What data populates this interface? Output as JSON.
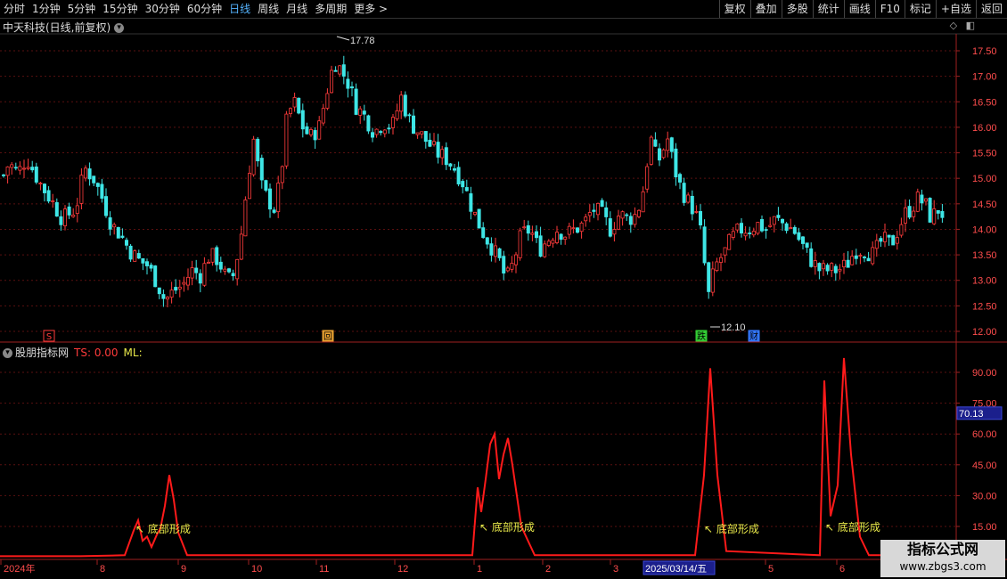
{
  "toolbar": {
    "left": [
      "分时",
      "1分钟",
      "5分钟",
      "15分钟",
      "30分钟",
      "60分钟",
      "日线",
      "周线",
      "月线",
      "多周期",
      "更多 >"
    ],
    "active": "日线",
    "right": [
      "复权",
      "叠加",
      "多股",
      "统计",
      "画线",
      "F10",
      "标记",
      "+自选",
      "返回"
    ]
  },
  "main_chart": {
    "title": "中天科技(日线,前复权)",
    "y_ticks": [
      "17.50",
      "17.00",
      "16.50",
      "16.00",
      "15.50",
      "15.00",
      "14.50",
      "14.00",
      "13.50",
      "13.00",
      "12.50",
      "12.00"
    ],
    "high_label": "17.78",
    "low_label": "12.10",
    "markers": [
      {
        "label": "S",
        "color": "#ff3b3b"
      },
      {
        "label": "回",
        "color": "#e8a030"
      },
      {
        "label": "跌",
        "color": "#33cc33"
      },
      {
        "label": "财",
        "color": "#3377ff"
      }
    ]
  },
  "indicator": {
    "name": "股朋指标网",
    "ts_label": "TS: 0.00",
    "ml_label": "ML:",
    "y_ticks": [
      "90.00",
      "75.00",
      "60.00",
      "45.00",
      "30.00",
      "15.00"
    ],
    "current_value": "70.13",
    "signal_text": "底部形成"
  },
  "x_axis": {
    "labels": [
      "2024年",
      "8",
      "9",
      "10",
      "11",
      "12",
      "1",
      "2",
      "3",
      "2025/03/14/五",
      "5",
      "6"
    ]
  },
  "watermark": {
    "line1": "指标公式网",
    "line2": "www.zbgs3.com"
  },
  "colors": {
    "up": "#ff3b3b",
    "down": "#3ee6e6",
    "indicator_line": "#ff1a1a",
    "signal": "#e8e84a",
    "axis_text": "#ff4d4d"
  }
}
